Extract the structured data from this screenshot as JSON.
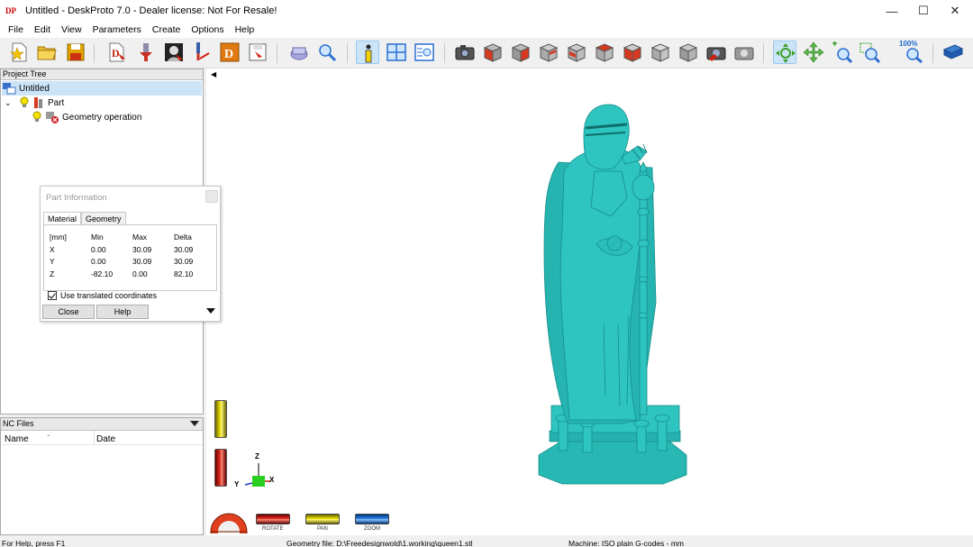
{
  "window": {
    "title": "Untitled - DeskProto 7.0 - Dealer license: Not For Resale!",
    "app_icon_text": "DP",
    "minimize_glyph": "—",
    "maximize_glyph": "☐",
    "close_glyph": "✕"
  },
  "menu": [
    "File",
    "Edit",
    "View",
    "Parameters",
    "Create",
    "Options",
    "Help"
  ],
  "toolbar": {
    "zoom_label": "100%",
    "icons": [
      "new-file-icon",
      "open-folder-icon",
      "save-icon",
      "part-wizard-icon",
      "toolpath-wizard-icon",
      "relief-wizard-icon",
      "tool-icon",
      "load-geometry-icon",
      "save-nc-icon",
      "show-paths-icon",
      "zoom-paths-icon",
      "info-icon",
      "layout-icon",
      "properties-icon",
      "snapshot-icon",
      "view-front-icon",
      "view-back-icon",
      "view-left-icon",
      "view-right-icon",
      "view-top-icon",
      "view-bottom-icon",
      "view-iso-icon",
      "view-shaded-icon",
      "redraw-icon",
      "rotate-icon",
      "pan-icon",
      "zoom-in-icon",
      "zoom-window-icon",
      "zoom-100-icon",
      "help-book-icon"
    ]
  },
  "project_tree": {
    "header": "Project Tree",
    "root": "Untitled",
    "part": "Part",
    "operation": "Geometry operation"
  },
  "nc_files": {
    "header": "NC Files",
    "columns": [
      "Name",
      "Date"
    ]
  },
  "part_info": {
    "title": "Part Information",
    "tabs": [
      "Material",
      "Geometry"
    ],
    "active_tab": "Material",
    "table": {
      "header": [
        "[mm]",
        "Min",
        "Max",
        "Delta"
      ],
      "rows": [
        [
          "X",
          "0.00",
          "30.09",
          "30.09"
        ],
        [
          "Y",
          "0.00",
          "30.09",
          "30.09"
        ],
        [
          "Z",
          "-82.10",
          "0.00",
          "82.10"
        ]
      ]
    },
    "checkbox_label": "Use translated coordinates",
    "checkbox_checked": true,
    "buttons": [
      "Close",
      "Help"
    ]
  },
  "viewport": {
    "axes": [
      "Z",
      "Y",
      "X"
    ],
    "dial_labels": [
      "ROTATE",
      "PAN",
      "ZOOM"
    ],
    "model_color": "#2ec4c0"
  },
  "status_bar": {
    "help": "For Help, press F1",
    "geometry_file": "Geometry file: D:\\Freedesignwold\\1.working\\queen1.stl",
    "machine": "Machine: ISO plain G-codes - mm"
  }
}
